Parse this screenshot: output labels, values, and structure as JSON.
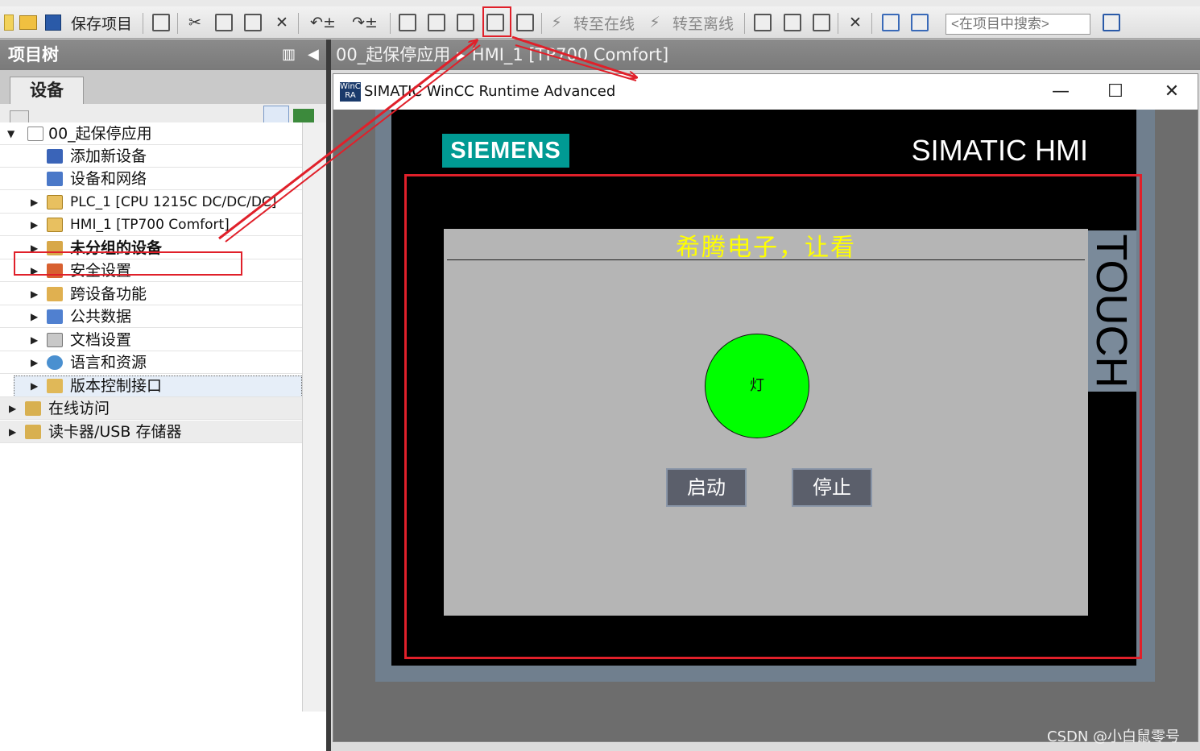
{
  "toolbar": {
    "save_project_label": "保存项目",
    "go_online_label": "转至在线",
    "go_offline_label": "转至离线",
    "search_placeholder": "<在项目中搜索>"
  },
  "project_tree": {
    "header_title": "项目树",
    "tab_devices": "设备",
    "items": [
      {
        "label": "00_起保停应用",
        "level": 0,
        "expanded": true
      },
      {
        "label": "添加新设备",
        "level": 1
      },
      {
        "label": "设备和网络",
        "level": 1
      },
      {
        "label": "PLC_1 [CPU 1215C DC/DC/DC]",
        "level": 1
      },
      {
        "label": "HMI_1 [TP700 Comfort]",
        "level": 1,
        "selected": true
      },
      {
        "label": "未分组的设备",
        "level": 1,
        "bold": true
      },
      {
        "label": "安全设置",
        "level": 1
      },
      {
        "label": "跨设备功能",
        "level": 1
      },
      {
        "label": "公共数据",
        "level": 1
      },
      {
        "label": "文档设置",
        "level": 1
      },
      {
        "label": "语言和资源",
        "level": 1
      },
      {
        "label": "版本控制接口",
        "level": 1
      },
      {
        "label": "在线访问",
        "level": 0
      },
      {
        "label": "读卡器/USB 存储器",
        "level": 0
      }
    ]
  },
  "editor": {
    "breadcrumb_project": "00_起保停应用",
    "breadcrumb_device": "HMI_1 [TP700 Comfort]"
  },
  "runtime_window": {
    "title": "SIMATIC WinCC Runtime Advanced",
    "icon_text": "WinCC RA",
    "panel": {
      "brand": "SIEMENS",
      "model": "SIMATIC HMI",
      "side_label": "TOUCH"
    },
    "screen": {
      "title": "希腾电子，让看",
      "lamp_label": "灯",
      "start_label": "启动",
      "stop_label": "停止"
    }
  },
  "colors": {
    "highlight_red": "#e0202a",
    "siemens_teal": "#009a93",
    "lamp_green": "#00ff00",
    "title_yellow": "#ffff00"
  },
  "watermark": "CSDN @小白鼠零号"
}
